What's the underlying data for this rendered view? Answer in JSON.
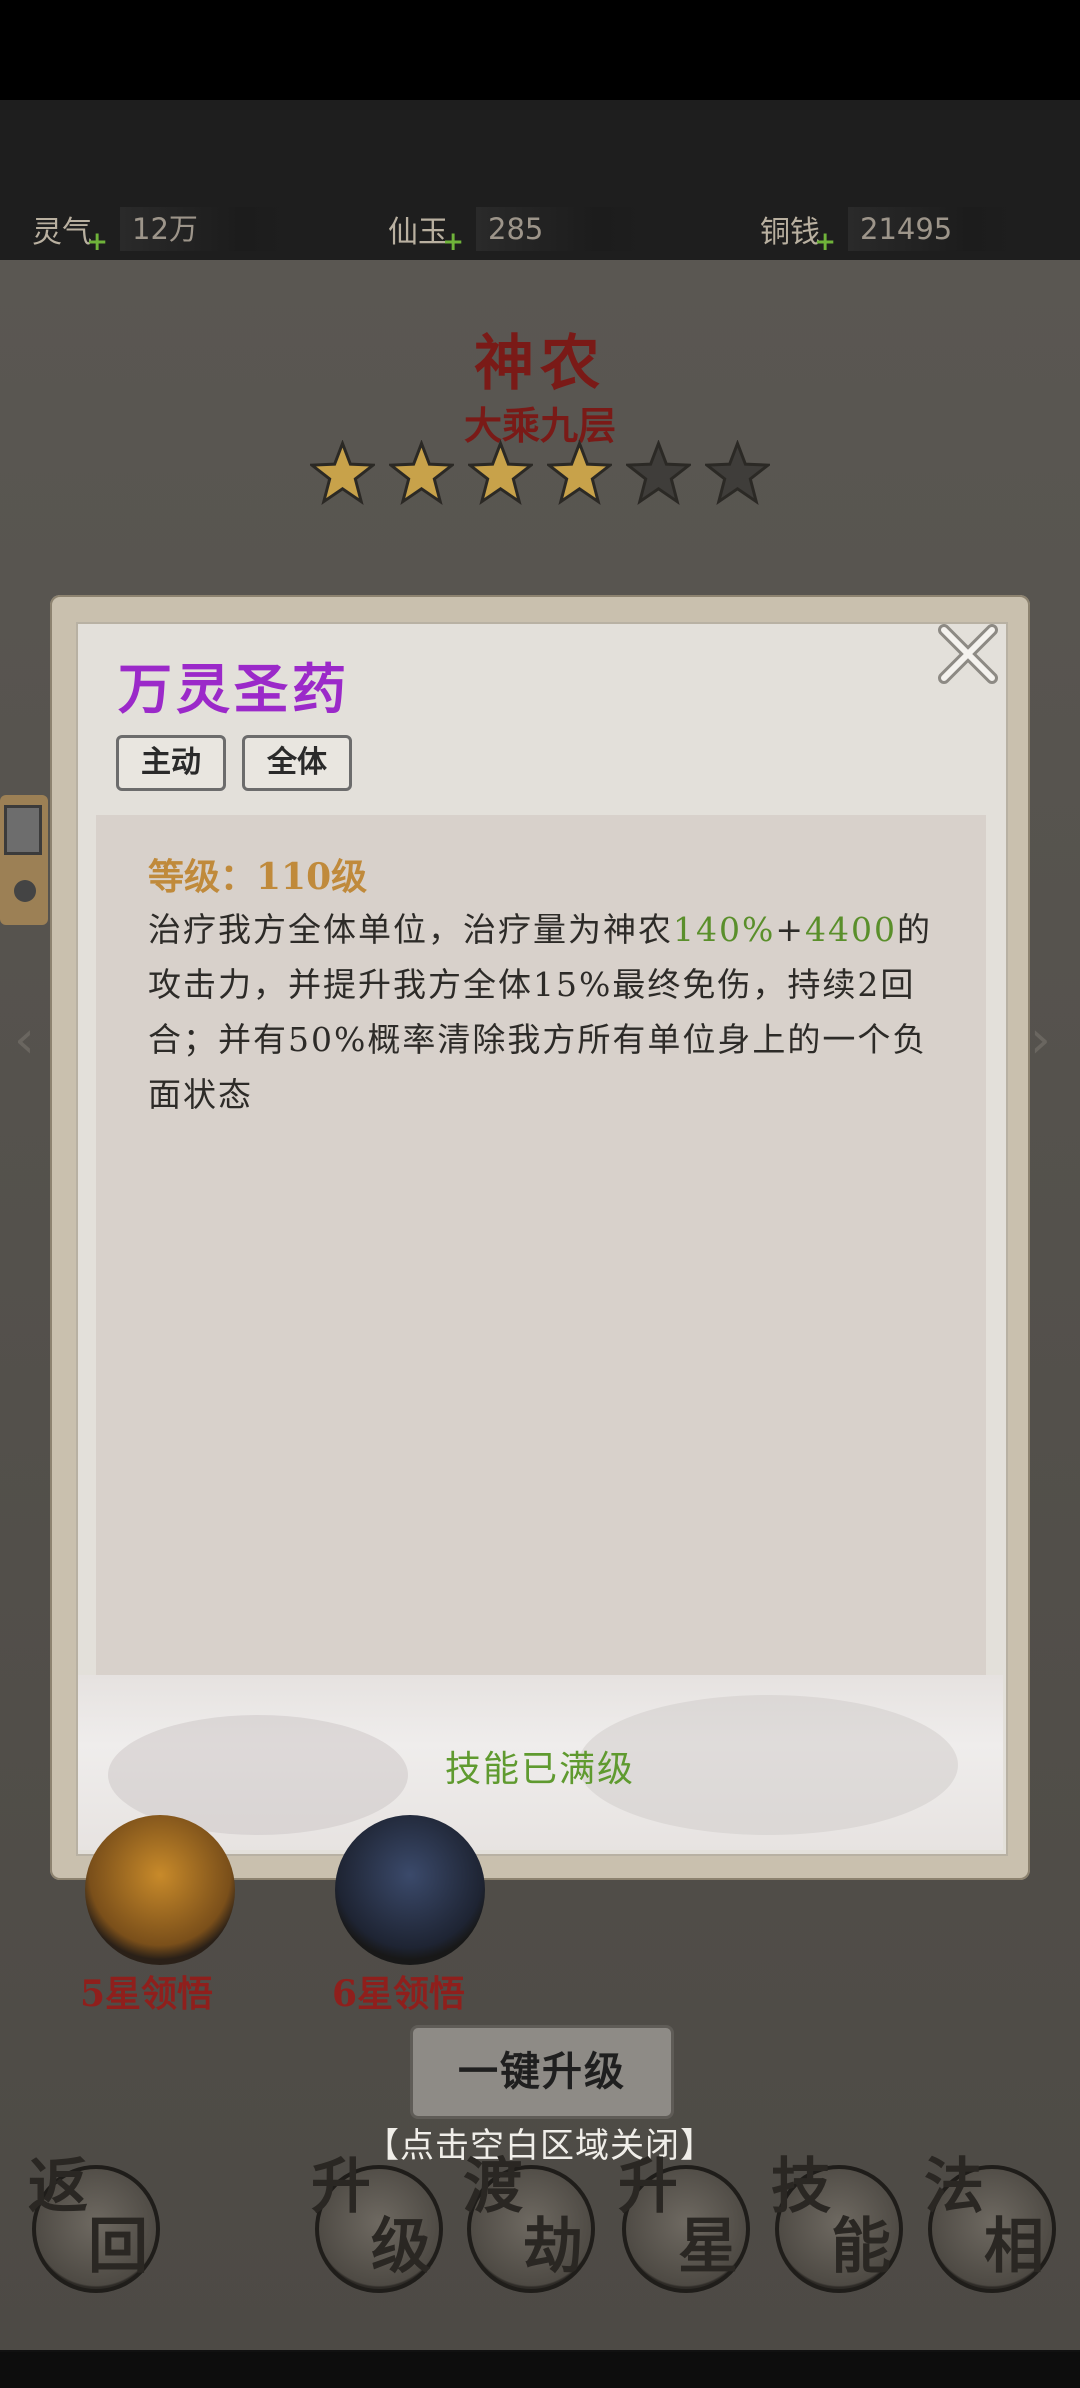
{
  "resources": [
    {
      "label": "灵气",
      "plus": "+",
      "value": "12万"
    },
    {
      "label": "仙玉",
      "plus": "+",
      "value": "285"
    },
    {
      "label": "铜钱",
      "plus": "+",
      "value": "21495"
    }
  ],
  "hero": {
    "name": "神农",
    "rank": "大乘九层",
    "stars_filled": 4,
    "stars_total": 6
  },
  "dialog": {
    "skill_name": "万灵圣药",
    "tags": [
      "主动",
      "全体"
    ],
    "level_label": "等级：110级",
    "desc_part1": "治疗我方全体单位，治疗量为神农",
    "desc_hl1": "140%",
    "desc_plus": "+",
    "desc_hl2": "4400",
    "desc_part2": "的攻击力，并提升我方全体15%最终免伤，持续2回合；并有50%概率清除我方所有单位身上的一个负面状态",
    "max_status": "技能已满级"
  },
  "background": {
    "orb_labels": [
      "5星领悟",
      "6星领悟"
    ],
    "upgrade_all_label": "一键升级",
    "close_hint": "【点击空白区域关闭】",
    "nav": [
      {
        "c1": "返",
        "c2": "回"
      },
      {
        "c1": "升",
        "c2": "级"
      },
      {
        "c1": "渡",
        "c2": "劫"
      },
      {
        "c1": "升",
        "c2": "星"
      },
      {
        "c1": "技",
        "c2": "能"
      },
      {
        "c1": "法",
        "c2": "相"
      }
    ]
  },
  "colors": {
    "skill_name": "#9b29c9",
    "level": "#c08a3b",
    "highlight": "#5a8f2b",
    "hero_name": "#7a1a17",
    "star_filled": "#c8a24a",
    "star_empty": "#3f3d3a"
  }
}
